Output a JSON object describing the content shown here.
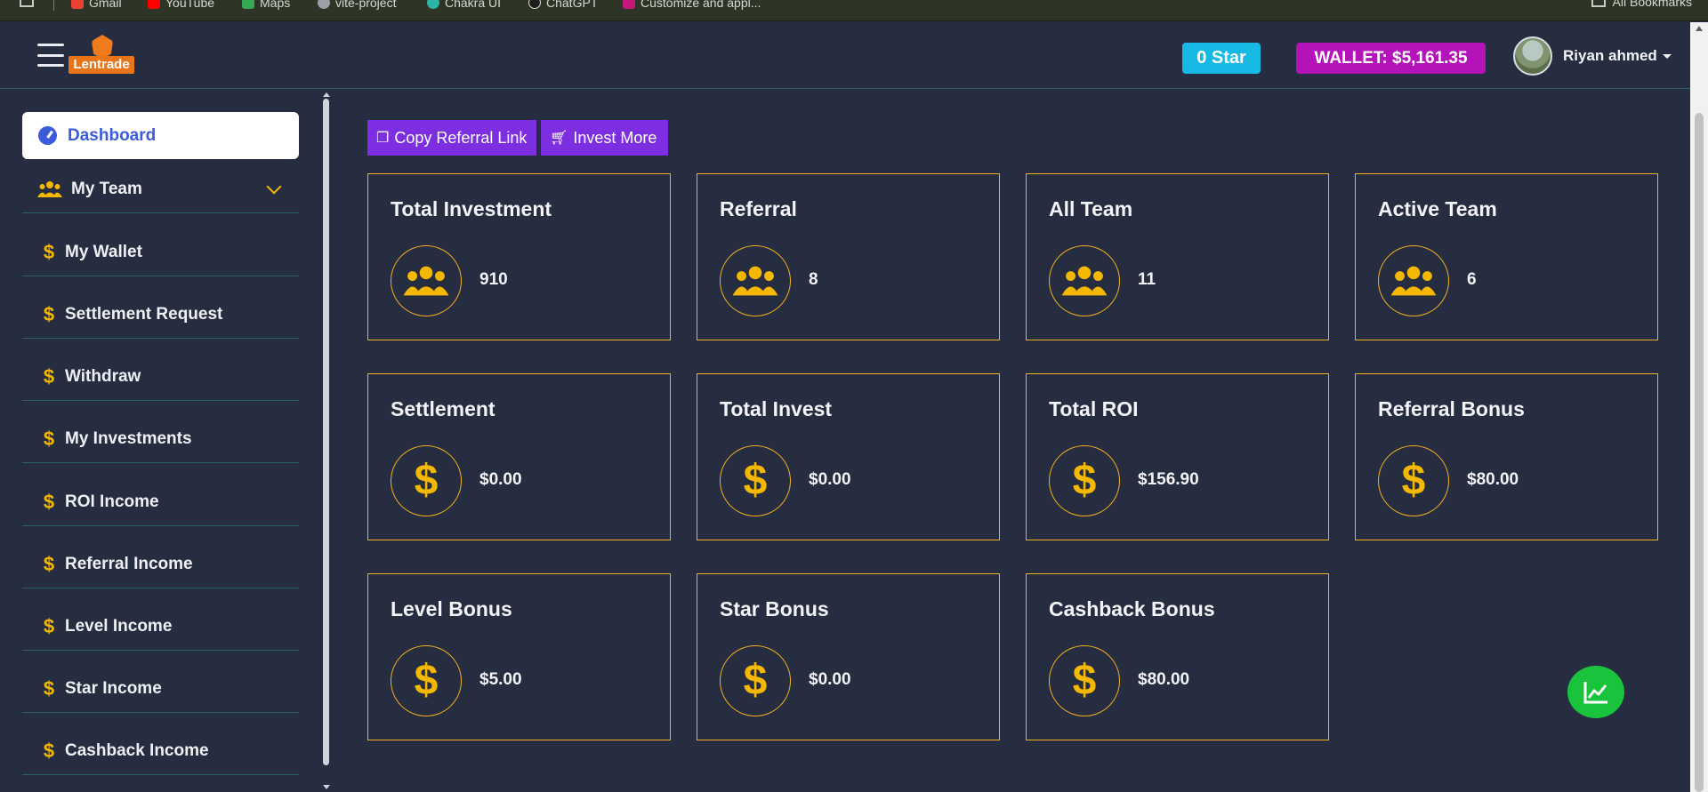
{
  "browser": {
    "bookmarks": [
      {
        "label": "Gmail",
        "icon": "gmail-icon",
        "color": "#ea4335"
      },
      {
        "label": "YouTube",
        "icon": "youtube-icon",
        "color": "#ff0000"
      },
      {
        "label": "Maps",
        "icon": "maps-icon",
        "color": "#34a853"
      },
      {
        "label": "vite-project",
        "icon": "globe-icon",
        "color": "#9aa0a6"
      },
      {
        "label": "Chakra UI",
        "icon": "chakra-icon",
        "color": "#2bb5a7"
      },
      {
        "label": "ChatGPT",
        "icon": "chatgpt-icon",
        "color": "#1e1e1e"
      },
      {
        "label": "Customize and appl...",
        "icon": "extension-icon",
        "color": "#c4197a"
      }
    ],
    "all_bookmarks": "All Bookmarks"
  },
  "header": {
    "logo_text": "Lentrade",
    "star_badge": "0 Star",
    "wallet_badge": "WALLET: $5,161.35",
    "user_name": "Riyan ahmed"
  },
  "sidebar": {
    "items": [
      {
        "label": "Dashboard",
        "icon": "dashboard-icon"
      },
      {
        "label": "My Team",
        "icon": "team-icon"
      },
      {
        "label": "My Wallet",
        "icon": "dollar-icon"
      },
      {
        "label": "Settlement Request",
        "icon": "dollar-icon"
      },
      {
        "label": "Withdraw",
        "icon": "dollar-icon"
      },
      {
        "label": "My Investments",
        "icon": "dollar-icon"
      },
      {
        "label": "ROI Income",
        "icon": "dollar-icon"
      },
      {
        "label": "Referral Income",
        "icon": "dollar-icon"
      },
      {
        "label": "Level Income",
        "icon": "dollar-icon"
      },
      {
        "label": "Star Income",
        "icon": "dollar-icon"
      },
      {
        "label": "Cashback Income",
        "icon": "dollar-icon"
      }
    ]
  },
  "actions": {
    "copy_referral": "Copy Referral Link",
    "invest_more": "Invest More"
  },
  "cards": [
    {
      "title": "Total Investment",
      "value": "910",
      "icon": "team-icon"
    },
    {
      "title": "Referral",
      "value": "8",
      "icon": "team-icon"
    },
    {
      "title": "All Team",
      "value": "11",
      "icon": "team-icon"
    },
    {
      "title": "Active Team",
      "value": "6",
      "icon": "team-icon"
    },
    {
      "title": "Settlement",
      "value": "$0.00",
      "icon": "dollar-icon"
    },
    {
      "title": "Total Invest",
      "value": "$0.00",
      "icon": "dollar-icon"
    },
    {
      "title": "Total ROI",
      "value": "$156.90",
      "icon": "dollar-icon"
    },
    {
      "title": "Referral Bonus",
      "value": "$80.00",
      "icon": "dollar-icon"
    },
    {
      "title": "Level Bonus",
      "value": "$5.00",
      "icon": "dollar-icon"
    },
    {
      "title": "Star Bonus",
      "value": "$0.00",
      "icon": "dollar-icon"
    },
    {
      "title": "Cashback Bonus",
      "value": "$80.00",
      "icon": "dollar-icon"
    }
  ],
  "colors": {
    "background": "#272d40",
    "accent_gold": "#f5b800",
    "button_purple": "#7c2ee0",
    "star_badge": "#17b8e3",
    "wallet_badge": "#b313b9",
    "fab_green": "#19c43c",
    "active_blue": "#3b5bdb"
  }
}
